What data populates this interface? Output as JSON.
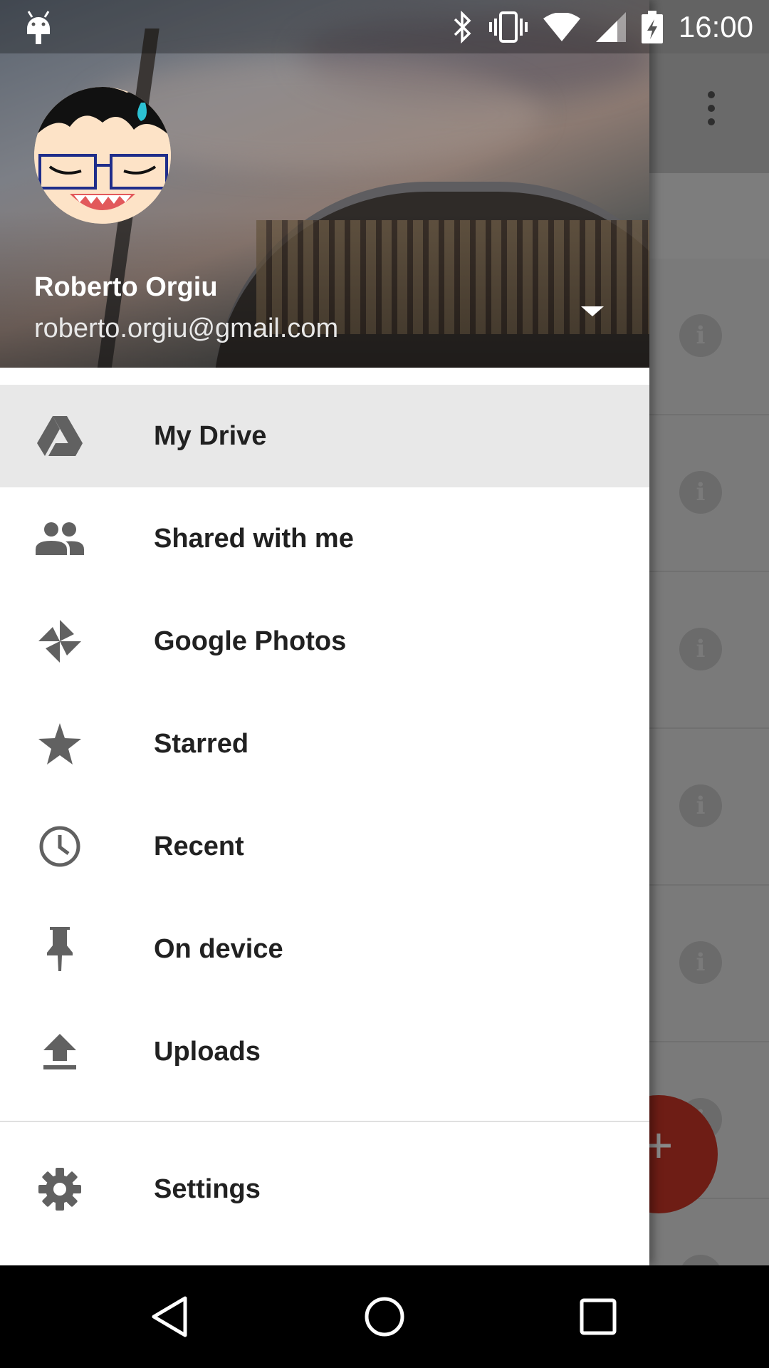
{
  "status_bar": {
    "time": "16:00",
    "icons": [
      "android-notification-icon",
      "bluetooth-icon",
      "vibrate-icon",
      "wifi-icon",
      "signal-icon",
      "battery-charging-icon"
    ]
  },
  "account": {
    "name": "Roberto Orgiu",
    "email": "roberto.orgiu@gmail.com"
  },
  "menu": {
    "items": [
      {
        "label": "My Drive",
        "icon": "drive-icon",
        "active": true
      },
      {
        "label": "Shared with me",
        "icon": "people-icon"
      },
      {
        "label": "Google Photos",
        "icon": "photos-icon"
      },
      {
        "label": "Starred",
        "icon": "star-icon"
      },
      {
        "label": "Recent",
        "icon": "clock-icon"
      },
      {
        "label": "On device",
        "icon": "pin-icon"
      },
      {
        "label": "Uploads",
        "icon": "upload-icon"
      }
    ],
    "settings": {
      "label": "Settings",
      "icon": "gear-icon"
    }
  },
  "fab": {
    "symbol": "+"
  },
  "nav_bar": {
    "icons": [
      "back-icon",
      "home-icon",
      "recents-icon"
    ]
  },
  "colors": {
    "active_item_bg": "#e8e8e8",
    "icon_gray": "#616161",
    "fab_red": "#6e1d15"
  }
}
